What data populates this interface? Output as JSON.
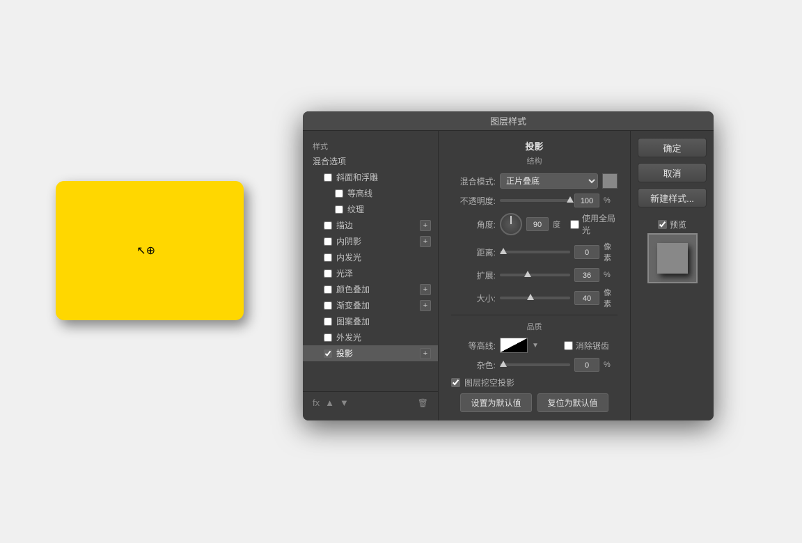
{
  "canvas": {
    "background": "#f0f0f0"
  },
  "dialog": {
    "title": "图层样式",
    "ok_label": "确定",
    "cancel_label": "取消",
    "new_style_label": "新建样式...",
    "preview_label": "预览"
  },
  "left_panel": {
    "style_label": "样式",
    "blend_label": "混合选项",
    "items": [
      {
        "id": "bevel",
        "label": "斜面和浮雕",
        "checked": false,
        "indent": 1,
        "hasPlus": false
      },
      {
        "id": "contour",
        "label": "等高线",
        "checked": false,
        "indent": 2,
        "hasPlus": false
      },
      {
        "id": "texture",
        "label": "纹理",
        "checked": false,
        "indent": 2,
        "hasPlus": false
      },
      {
        "id": "stroke",
        "label": "描边",
        "checked": false,
        "indent": 1,
        "hasPlus": true
      },
      {
        "id": "inner-shadow",
        "label": "内阴影",
        "checked": false,
        "indent": 1,
        "hasPlus": true
      },
      {
        "id": "inner-glow",
        "label": "内发光",
        "checked": false,
        "indent": 1,
        "hasPlus": false
      },
      {
        "id": "satin",
        "label": "光泽",
        "checked": false,
        "indent": 1,
        "hasPlus": false
      },
      {
        "id": "color-overlay",
        "label": "颜色叠加",
        "checked": false,
        "indent": 1,
        "hasPlus": true
      },
      {
        "id": "gradient-overlay",
        "label": "渐变叠加",
        "checked": false,
        "indent": 1,
        "hasPlus": true
      },
      {
        "id": "pattern-overlay",
        "label": "图案叠加",
        "checked": false,
        "indent": 1,
        "hasPlus": false
      },
      {
        "id": "outer-glow",
        "label": "外发光",
        "checked": false,
        "indent": 1,
        "hasPlus": false
      },
      {
        "id": "drop-shadow",
        "label": "投影",
        "checked": true,
        "indent": 1,
        "hasPlus": true,
        "active": true
      }
    ],
    "footer": {
      "fx_label": "fx",
      "up_icon": "▲",
      "down_icon": "▼",
      "trash_icon": "🗑"
    }
  },
  "middle_panel": {
    "section_title": "投影",
    "sub_title": "结构",
    "blend_mode_label": "混合模式:",
    "blend_mode_value": "正片叠底",
    "opacity_label": "不透明度:",
    "opacity_value": "100",
    "opacity_unit": "%",
    "angle_label": "角度:",
    "angle_value": "90",
    "angle_unit": "度",
    "use_global_light_label": "使用全局光",
    "use_global_light_checked": false,
    "distance_label": "距离:",
    "distance_value": "0",
    "distance_unit": "像素",
    "spread_label": "扩展:",
    "spread_value": "36",
    "spread_unit": "%",
    "size_label": "大小:",
    "size_value": "40",
    "size_unit": "像素",
    "quality_title": "品质",
    "contour_label": "等高线:",
    "anti_alias_label": "消除锯齿",
    "anti_alias_checked": false,
    "noise_label": "杂色:",
    "noise_value": "0",
    "noise_unit": "%",
    "layer_knockout_label": "图层挖空投影",
    "layer_knockout_checked": true,
    "set_default_label": "设置为默认值",
    "reset_default_label": "复位为默认值"
  }
}
